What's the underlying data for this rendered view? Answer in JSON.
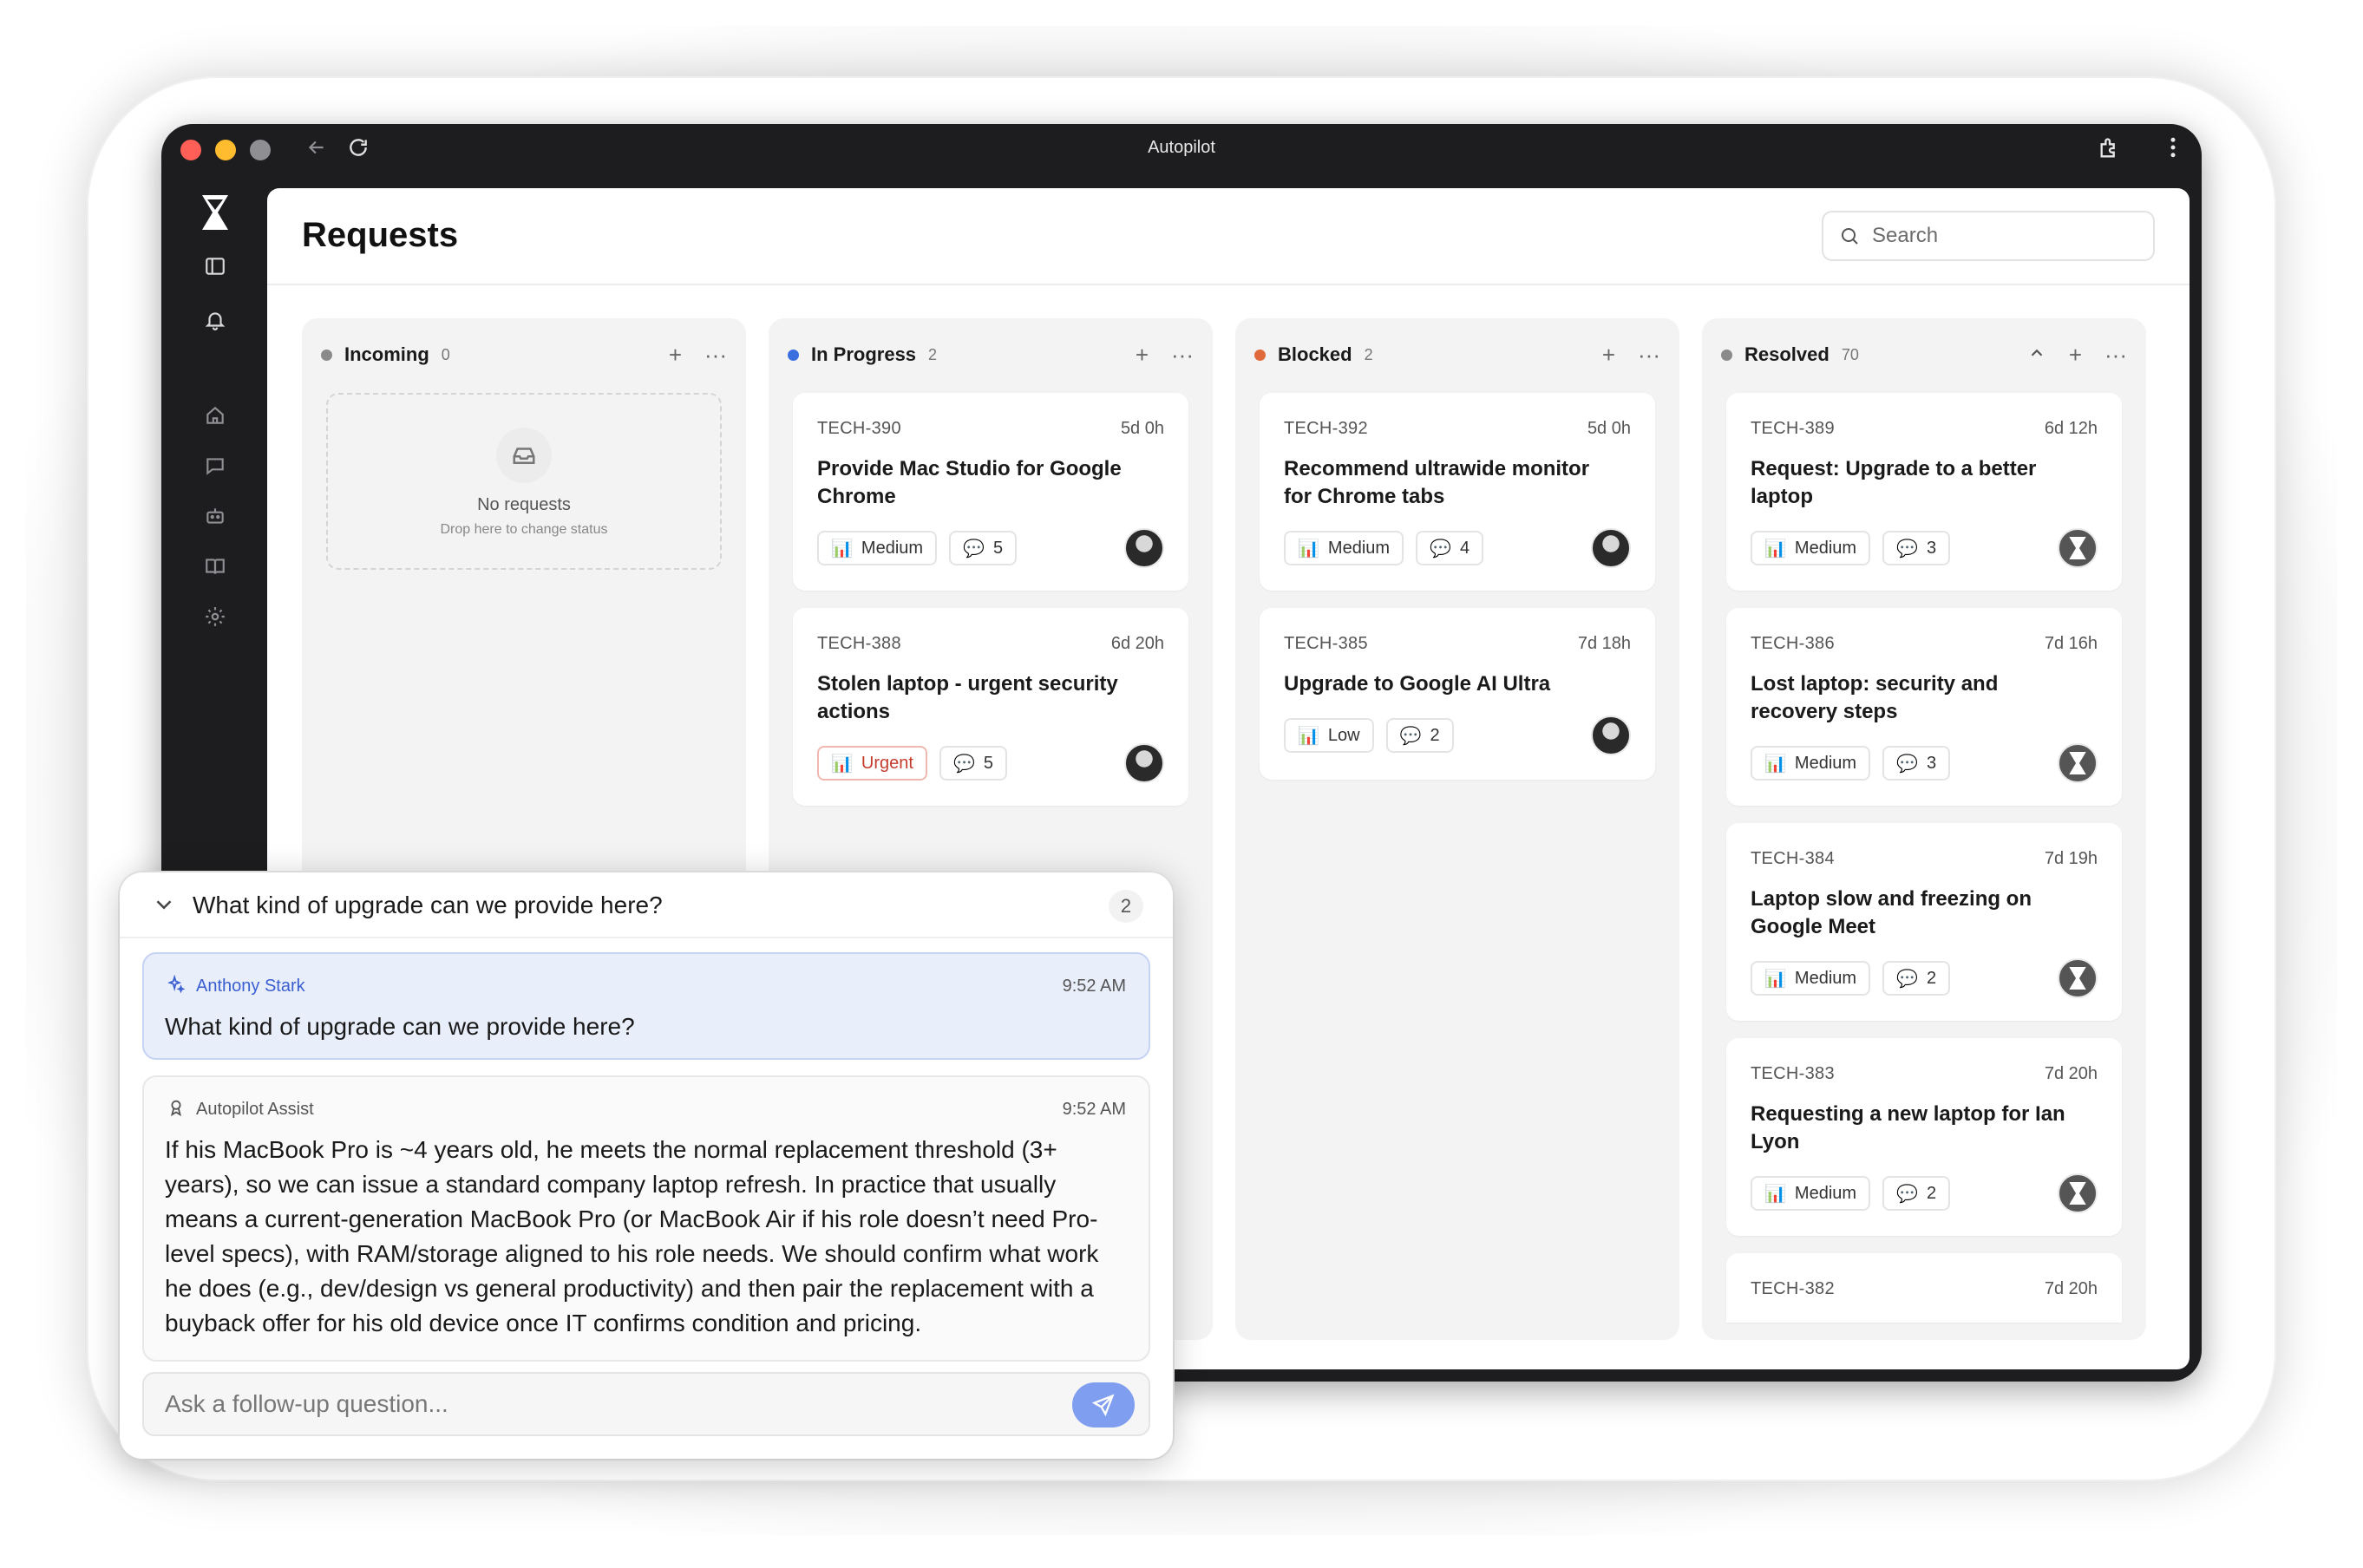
{
  "window": {
    "title": "Autopilot"
  },
  "page": {
    "title": "Requests"
  },
  "search": {
    "placeholder": "Search"
  },
  "colors": {
    "incoming": "#8a8a8a",
    "in_progress": "#3b6fe0",
    "blocked": "#e06a3b",
    "resolved": "#8a8a8a",
    "urgent": "#c43c2c",
    "accent": "#7f9ef0"
  },
  "columns": [
    {
      "name": "Incoming",
      "count": "0",
      "empty": {
        "title": "No requests",
        "subtitle": "Drop here to change status"
      },
      "cards": []
    },
    {
      "name": "In Progress",
      "count": "2",
      "cards": [
        {
          "id": "TECH-390",
          "age": "5d 0h",
          "title": "Provide Mac Studio for Google Chrome",
          "priority": "Medium",
          "comments": "5"
        },
        {
          "id": "TECH-388",
          "age": "6d 20h",
          "title": "Stolen laptop - urgent security actions",
          "priority": "Urgent",
          "comments": "5"
        }
      ]
    },
    {
      "name": "Blocked",
      "count": "2",
      "cards": [
        {
          "id": "TECH-392",
          "age": "5d 0h",
          "title": "Recommend ultrawide monitor for Chrome tabs",
          "priority": "Medium",
          "comments": "4"
        },
        {
          "id": "TECH-385",
          "age": "7d 18h",
          "title": "Upgrade to Google AI Ultra",
          "priority": "Low",
          "comments": "2"
        }
      ]
    },
    {
      "name": "Resolved",
      "count": "70",
      "cards": [
        {
          "id": "TECH-389",
          "age": "6d 12h",
          "title": "Request: Upgrade to a better laptop",
          "priority": "Medium",
          "comments": "3"
        },
        {
          "id": "TECH-386",
          "age": "7d 16h",
          "title": "Lost laptop: security and recovery steps",
          "priority": "Medium",
          "comments": "3"
        },
        {
          "id": "TECH-384",
          "age": "7d 19h",
          "title": "Laptop slow and freezing on Google Meet",
          "priority": "Medium",
          "comments": "2"
        },
        {
          "id": "TECH-383",
          "age": "7d 20h",
          "title": "Requesting a new laptop for Ian Lyon",
          "priority": "Medium",
          "comments": "2"
        },
        {
          "id": "TECH-382",
          "age": "7d 20h",
          "title": "",
          "priority": "",
          "comments": ""
        }
      ]
    }
  ],
  "chat": {
    "question": "What kind of upgrade can we provide here?",
    "count": "2",
    "messages": [
      {
        "author": "Anthony Stark",
        "time": "9:52 AM",
        "text": "What kind of upgrade can we provide here?"
      },
      {
        "author": "Autopilot Assist",
        "time": "9:52 AM",
        "text": "If his MacBook Pro is ~4 years old, he meets the normal replacement threshold (3+ years), so we can issue a standard company laptop refresh. In practice that usually means a current-generation MacBook Pro (or MacBook Air if his role doesn’t need Pro-level specs), with RAM/storage aligned to his role needs. We should confirm what work he does (e.g., dev/design vs general productivity) and then pair the replacement with a buyback offer for his old device once IT confirms condition and pricing."
      }
    ],
    "input_placeholder": "Ask a follow-up question..."
  }
}
